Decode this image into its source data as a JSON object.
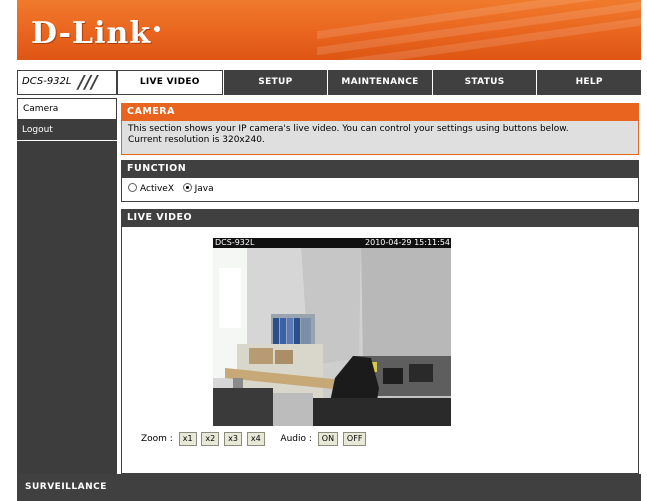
{
  "brand": {
    "logo": "D-Link"
  },
  "model": "DCS-932L",
  "nav": {
    "tabs": [
      {
        "label": "LIVE VIDEO",
        "active": true
      },
      {
        "label": "SETUP",
        "active": false
      },
      {
        "label": "MAINTENANCE",
        "active": false
      },
      {
        "label": "STATUS",
        "active": false
      },
      {
        "label": "HELP",
        "active": false
      }
    ]
  },
  "sidebar": {
    "items": [
      {
        "label": "Camera",
        "active": true
      },
      {
        "label": "Logout",
        "active": false
      }
    ]
  },
  "camera_section": {
    "title": "CAMERA",
    "line1": "This section shows your IP camera's live video. You can control your settings using buttons below.",
    "line2": "Current resolution is 320x240."
  },
  "function_section": {
    "title": "FUNCTION",
    "options": [
      {
        "label": "ActiveX",
        "selected": false
      },
      {
        "label": "Java",
        "selected": true
      }
    ]
  },
  "live_section": {
    "title": "LIVE VIDEO",
    "overlay_name": "DCS-932L",
    "overlay_time": "2010-04-29 15:11:54"
  },
  "controls": {
    "zoom_label": "Zoom :",
    "zoom_buttons": [
      "x1",
      "x2",
      "x3",
      "x4"
    ],
    "audio_label": "Audio :",
    "audio_buttons": [
      "ON",
      "OFF"
    ]
  },
  "footer": {
    "text": "SURVEILLANCE"
  },
  "colors": {
    "accent": "#e9651f",
    "dark": "#404040",
    "desc_bg": "#dfdfdf"
  }
}
